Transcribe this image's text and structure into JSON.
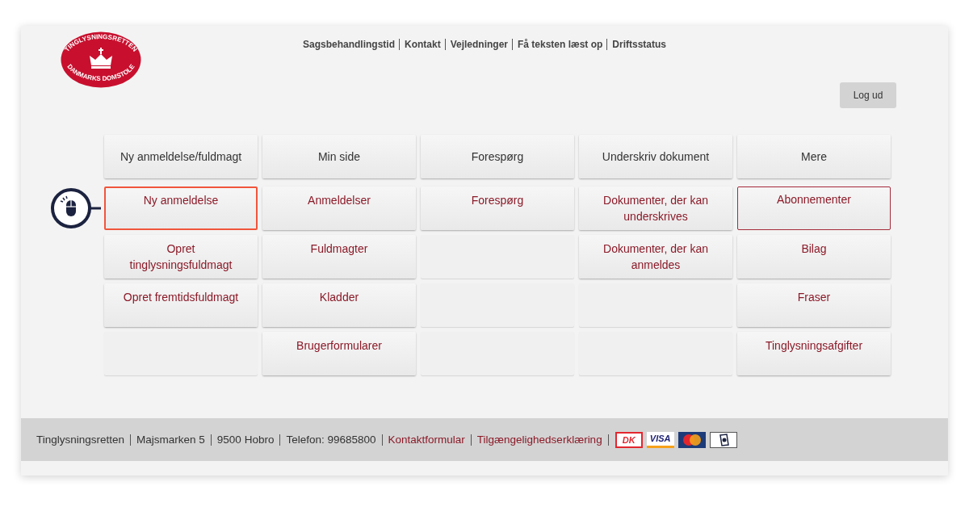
{
  "logo": {
    "top_text": "TINGLYSNINGSRETTEN",
    "bottom_text": "DANMARKS DOMSTOLE"
  },
  "top_links": [
    "Sagsbehandlingstid",
    "Kontakt",
    "Vejledninger",
    "Få teksten læst op",
    "Driftsstatus"
  ],
  "logout_button": "Log ud",
  "menu": {
    "headers": [
      "Ny anmeldelse/fuldmagt",
      "Min side",
      "Forespørg",
      "Underskriv dokument",
      "Mere"
    ],
    "columns": [
      [
        {
          "kind": "callout",
          "label": "Ny anmeldelse"
        },
        {
          "kind": "link",
          "label": "Opret tinglysningsfuldmagt"
        },
        {
          "kind": "link",
          "label": "Opret fremtidsfuldmagt"
        },
        {
          "kind": "empty"
        }
      ],
      [
        {
          "kind": "link",
          "label": "Anmeldelser"
        },
        {
          "kind": "link",
          "label": "Fuldmagter"
        },
        {
          "kind": "link",
          "label": "Kladder"
        },
        {
          "kind": "link",
          "label": "Brugerformularer"
        }
      ],
      [
        {
          "kind": "link",
          "label": "Forespørg"
        },
        {
          "kind": "empty"
        },
        {
          "kind": "empty"
        },
        {
          "kind": "empty"
        }
      ],
      [
        {
          "kind": "link",
          "label": "Dokumenter, der kan underskrives"
        },
        {
          "kind": "link",
          "label": "Dokumenter, der kan anmeldes"
        },
        {
          "kind": "empty"
        },
        {
          "kind": "empty"
        }
      ],
      [
        {
          "kind": "current",
          "label": "Abonnementer"
        },
        {
          "kind": "link",
          "label": "Bilag"
        },
        {
          "kind": "link",
          "label": "Fraser"
        },
        {
          "kind": "link",
          "label": "Tinglysningsafgifter"
        }
      ]
    ]
  },
  "footer": {
    "items": [
      {
        "kind": "text",
        "label": "Tinglysningsretten"
      },
      {
        "kind": "text",
        "label": "Majsmarken 5"
      },
      {
        "kind": "text",
        "label": "9500 Hobro"
      },
      {
        "kind": "text",
        "label": "Telefon: 99685800"
      },
      {
        "kind": "link",
        "label": "Kontaktformular"
      },
      {
        "kind": "link",
        "label": "Tilgængelighedserklæring"
      }
    ],
    "cards": [
      {
        "kind": "dk",
        "label": "DK"
      },
      {
        "kind": "visa",
        "label": "VISA"
      },
      {
        "kind": "mastercard"
      },
      {
        "kind": "secure"
      }
    ]
  }
}
